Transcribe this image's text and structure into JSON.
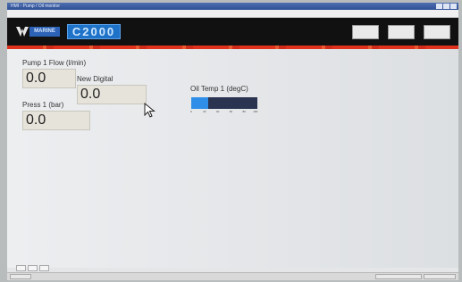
{
  "window": {
    "title": "HMI - Pump / Oil monitor"
  },
  "menu": [],
  "header": {
    "brand": "MARINE",
    "model": "C2000",
    "buttons": [
      {
        "line1": "",
        "line2": ""
      },
      {
        "line1": "",
        "line2": ""
      },
      {
        "line1": "",
        "line2": ""
      }
    ]
  },
  "colors": {
    "accent": "#e0321c",
    "header_bg": "#111111",
    "gauge_fill": "#2f8fe8",
    "gauge_bg": "#2a3350"
  },
  "displays": {
    "pump_flow": {
      "label": "Pump 1 Flow (l/min)",
      "value": "0.0"
    },
    "new_digital": {
      "label": "New Digital",
      "value": "0.0"
    },
    "press": {
      "label": "Press 1 (bar)",
      "value": "0.0"
    },
    "oil_temp": {
      "label": "Oil Temp 1 (degC)",
      "level": 0.26,
      "ticks": [
        "0",
        "20",
        "40",
        "60",
        "80",
        "100"
      ]
    }
  }
}
